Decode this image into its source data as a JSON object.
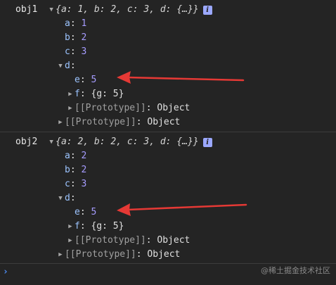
{
  "entries": [
    {
      "name": "obj1",
      "summary": "{a: 1, b: 2, c: 3, d: {…}}",
      "props": [
        {
          "key": "a",
          "value": "1"
        },
        {
          "key": "b",
          "value": "2"
        },
        {
          "key": "c",
          "value": "3"
        }
      ],
      "d_key": "d",
      "d_props": {
        "e_key": "e",
        "e_value": "5",
        "f_key": "f",
        "f_value": "{g: 5}",
        "proto_key": "[[Prototype]]",
        "proto_value": "Object"
      },
      "proto_key": "[[Prototype]]",
      "proto_value": "Object"
    },
    {
      "name": "obj2",
      "summary": "{a: 2, b: 2, c: 3, d: {…}}",
      "props": [
        {
          "key": "a",
          "value": "2"
        },
        {
          "key": "b",
          "value": "2"
        },
        {
          "key": "c",
          "value": "3"
        }
      ],
      "d_key": "d",
      "d_props": {
        "e_key": "e",
        "e_value": "5",
        "f_key": "f",
        "f_value": "{g: 5}",
        "proto_key": "[[Prototype]]",
        "proto_value": "Object"
      },
      "proto_key": "[[Prototype]]",
      "proto_value": "Object"
    }
  ],
  "info_icon_text": "i",
  "prompt_symbol": "›",
  "watermark": "@稀土掘金技术社区",
  "colors": {
    "background": "#242424",
    "key": "#9cc4ff",
    "number": "#a69cff",
    "arrow": "#e53935",
    "prompt": "#4d8ef8"
  }
}
